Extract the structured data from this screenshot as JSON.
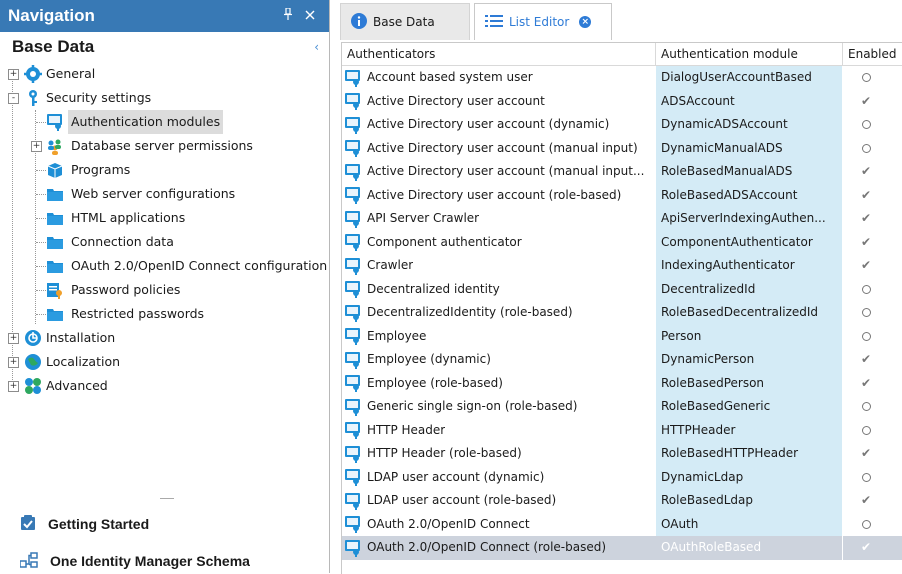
{
  "nav": {
    "title": "Navigation",
    "pin_icon": "pin-icon",
    "close_icon": "close-icon",
    "section_title": "Base Data",
    "tree": [
      {
        "label": "General",
        "icon": "gear-icon",
        "expander": "+"
      },
      {
        "label": "Security settings",
        "icon": "key-icon",
        "expander": "-"
      },
      {
        "label": "Authentication modules",
        "icon": "authenticator-icon",
        "selected": true
      },
      {
        "label": "Database server permissions",
        "icon": "users-icon",
        "expander": "+"
      },
      {
        "label": "Programs",
        "icon": "package-icon"
      },
      {
        "label": "Web server configurations",
        "icon": "folder-icon"
      },
      {
        "label": "HTML applications",
        "icon": "folder-icon"
      },
      {
        "label": "Connection data",
        "icon": "folder-icon"
      },
      {
        "label": "OAuth 2.0/OpenID Connect configuration",
        "icon": "folder-icon"
      },
      {
        "label": "Password policies",
        "icon": "password-policy-icon"
      },
      {
        "label": "Restricted passwords",
        "icon": "folder-icon"
      },
      {
        "label": "Installation",
        "icon": "installation-icon",
        "expander": "+"
      },
      {
        "label": "Localization",
        "icon": "globe-icon",
        "expander": "+"
      },
      {
        "label": "Advanced",
        "icon": "advanced-icon",
        "expander": "+"
      }
    ],
    "bottom": [
      {
        "label": "Getting Started",
        "icon": "getting-started-icon"
      },
      {
        "label": "One Identity Manager Schema",
        "icon": "schema-icon"
      }
    ]
  },
  "tabs": [
    {
      "label": "Base Data",
      "icon": "info-icon",
      "active": false
    },
    {
      "label": "List Editor",
      "icon": "list-icon",
      "active": true
    }
  ],
  "grid": {
    "columns": [
      "Authenticators",
      "Authentication module",
      "Enabled"
    ],
    "rows": [
      {
        "name": "Account based system user",
        "module": "DialogUserAccountBased",
        "enabled": false
      },
      {
        "name": "Active Directory user account",
        "module": "ADSAccount",
        "enabled": true
      },
      {
        "name": "Active Directory user account (dynamic)",
        "module": "DynamicADSAccount",
        "enabled": false
      },
      {
        "name": "Active Directory user account (manual input)",
        "module": "DynamicManualADS",
        "enabled": false
      },
      {
        "name": "Active Directory user account (manual input...",
        "module": "RoleBasedManualADS",
        "enabled": true
      },
      {
        "name": "Active Directory user account (role-based)",
        "module": "RoleBasedADSAccount",
        "enabled": true
      },
      {
        "name": "API Server Crawler",
        "module": "ApiServerIndexingAuthen...",
        "enabled": true
      },
      {
        "name": "Component authenticator",
        "module": "ComponentAuthenticator",
        "enabled": true
      },
      {
        "name": "Crawler",
        "module": "IndexingAuthenticator",
        "enabled": true
      },
      {
        "name": "Decentralized identity",
        "module": "DecentralizedId",
        "enabled": false
      },
      {
        "name": "DecentralizedIdentity (role-based)",
        "module": "RoleBasedDecentralizedId",
        "enabled": false
      },
      {
        "name": "Employee",
        "module": "Person",
        "enabled": false
      },
      {
        "name": "Employee (dynamic)",
        "module": "DynamicPerson",
        "enabled": true
      },
      {
        "name": "Employee (role-based)",
        "module": "RoleBasedPerson",
        "enabled": true
      },
      {
        "name": "Generic single sign-on (role-based)",
        "module": "RoleBasedGeneric",
        "enabled": false
      },
      {
        "name": "HTTP Header",
        "module": "HTTPHeader",
        "enabled": false
      },
      {
        "name": "HTTP Header (role-based)",
        "module": "RoleBasedHTTPHeader",
        "enabled": true
      },
      {
        "name": "LDAP user account (dynamic)",
        "module": "DynamicLdap",
        "enabled": false
      },
      {
        "name": "LDAP user account (role-based)",
        "module": "RoleBasedLdap",
        "enabled": true
      },
      {
        "name": "OAuth 2.0/OpenID Connect",
        "module": "OAuth",
        "enabled": false
      },
      {
        "name": "OAuth 2.0/OpenID Connect (role-based)",
        "module": "OAuthRoleBased",
        "enabled": true,
        "selected": true
      }
    ]
  },
  "colors": {
    "nav_header": "#3879b5",
    "accent_blue": "#2e7bd6",
    "module_cell": "#d4ebf6",
    "selected_row": "#cdd3dd"
  }
}
